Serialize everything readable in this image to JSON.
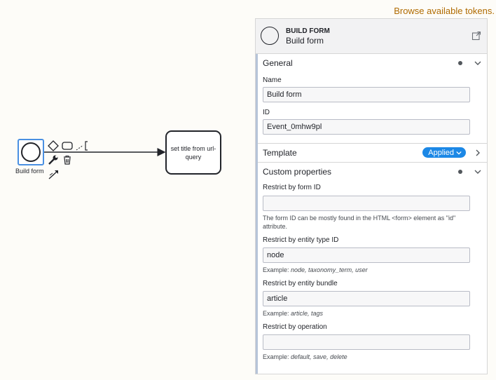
{
  "top_link": {
    "label": "Browse available tokens."
  },
  "canvas": {
    "start_event": {
      "label": "Build form"
    },
    "task": {
      "label": "set title from url-query"
    },
    "context_pad": {
      "icons": [
        "gateway-icon",
        "task-icon",
        "annotation-icon",
        "wrench-icon",
        "delete-icon",
        "connect-icon"
      ]
    }
  },
  "panel": {
    "header": {
      "type": "BUILD FORM",
      "name": "Build form"
    },
    "general": {
      "title": "General",
      "name_label": "Name",
      "name_value": "Build form",
      "id_label": "ID",
      "id_value": "Event_0mhw9pl"
    },
    "template": {
      "title": "Template",
      "badge": "Applied"
    },
    "custom": {
      "title": "Custom properties",
      "form_id": {
        "label": "Restrict by form ID",
        "value": "",
        "desc": "The form ID can be mostly found in the HTML <form> element as \"id\" attribute."
      },
      "entity_type": {
        "label": "Restrict by entity type ID",
        "value": "node",
        "desc_prefix": "Example: ",
        "desc_example": "node, taxonomy_term, user"
      },
      "bundle": {
        "label": "Restrict by entity bundle",
        "value": "article",
        "desc_prefix": "Example: ",
        "desc_example": "article, tags"
      },
      "operation": {
        "label": "Restrict by operation",
        "value": "",
        "desc_prefix": "Example: ",
        "desc_example": "default, save, delete"
      }
    }
  },
  "colors": {
    "accent": "#1c88e6",
    "link": "#b06b00",
    "selection": "#4a90e2"
  }
}
